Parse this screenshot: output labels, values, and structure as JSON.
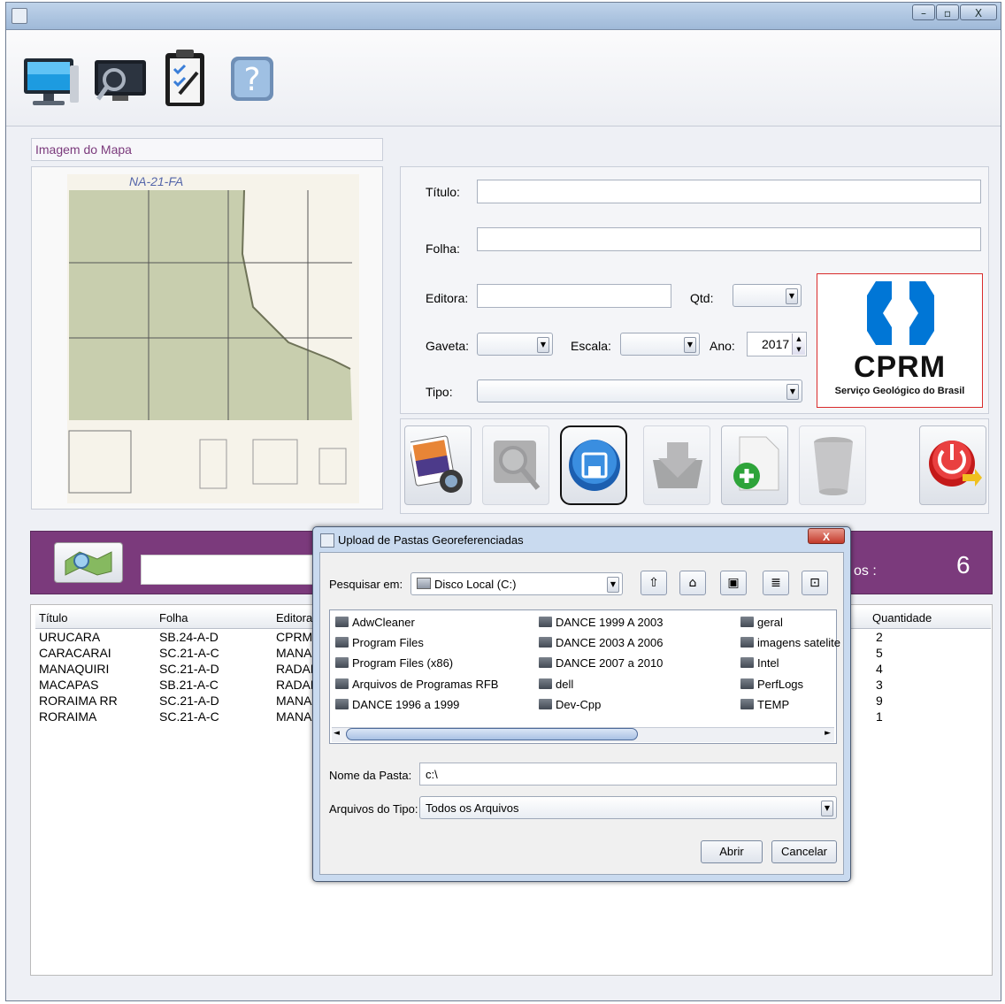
{
  "window": {
    "minimize_label": "–",
    "maximize_label": "▫",
    "close_label": "X"
  },
  "map_panel": {
    "title": "Imagem do Mapa",
    "sheet_code": "NA-21-FA"
  },
  "form": {
    "titulo_label": "Título:",
    "folha_label": "Folha:",
    "editora_label": "Editora:",
    "qtd_label": "Qtd:",
    "gaveta_label": "Gaveta:",
    "escala_label": "Escala:",
    "ano_label": "Ano:",
    "ano_value": "2017",
    "tipo_label": "Tipo:"
  },
  "logo": {
    "name": "CPRM",
    "subtitle": "Serviço Geológico do Brasil",
    "colors": {
      "brand_blue": "#0076d6",
      "border_red": "#d92b2b"
    }
  },
  "search_bar": {
    "count_label": "os :",
    "count_value": "6",
    "bar_color": "#7b3a7c"
  },
  "table": {
    "columns": [
      "Título",
      "Folha",
      "Editora",
      "Quantidade"
    ],
    "rows": [
      {
        "titulo": "URUCARA",
        "folha": "SB.24-A-D",
        "editora": "CPRM",
        "quantidade": "2"
      },
      {
        "titulo": "CARACARAI",
        "folha": "SC.21-A-C",
        "editora": "MANAU",
        "quantidade": "5"
      },
      {
        "titulo": "MANAQUIRI",
        "folha": "SC.21-A-D",
        "editora": "RADAN",
        "quantidade": "4"
      },
      {
        "titulo": "MACAPAS",
        "folha": "SB.21-A-C",
        "editora": "RADAN",
        "quantidade": "3"
      },
      {
        "titulo": "RORAIMA RR",
        "folha": "SC.21-A-D",
        "editora": "MANAU",
        "quantidade": "9"
      },
      {
        "titulo": "RORAIMA",
        "folha": "SC.21-A-C",
        "editora": "MANAU",
        "quantidade": "1"
      }
    ]
  },
  "dialog": {
    "title": "Upload de Pastas Georeferenciadas",
    "close_label": "X",
    "look_in_label": "Pesquisar em:",
    "look_in_value": "Disco Local (C:)",
    "files": [
      "AdwCleaner",
      "Program Files",
      "Program Files (x86)",
      "Arquivos de Programas RFB",
      "DANCE  1996 a 1999",
      "DANCE  1999 A 2003",
      "DANCE  2003 A 2006",
      "DANCE  2007 a 2010",
      "dell",
      "Dev-Cpp",
      "geral",
      "imagens satelite",
      "Intel",
      "PerfLogs",
      "TEMP"
    ],
    "folder_name_label": "Nome da Pasta:",
    "folder_name_value": "c:\\",
    "file_type_label": "Arquivos do Tipo:",
    "file_type_value": "Todos os Arquivos",
    "open_label": "Abrir",
    "cancel_label": "Cancelar"
  }
}
